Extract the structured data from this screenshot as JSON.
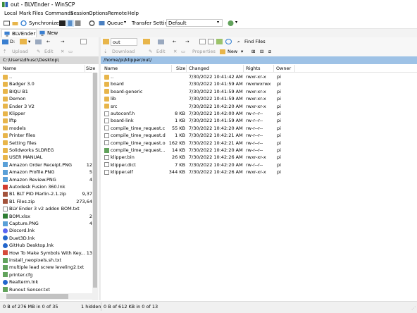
{
  "window": {
    "title": "out - BLVEnder - WinSCP"
  },
  "menu": [
    "Local",
    "Mark",
    "Files",
    "Commands",
    "Session",
    "Options",
    "Remote",
    "Help"
  ],
  "toolbar": {
    "synchronize_label": "Synchronize",
    "queue_label": "Queue",
    "transfer_settings_label": "Transfer Settings",
    "transfer_settings_value": "Default"
  },
  "tabs": [
    {
      "label": "BLVEnder",
      "active": true
    },
    {
      "label": "New Session",
      "active": false
    }
  ],
  "left_pane": {
    "drive_label": "D:",
    "upload_label": "Upload",
    "edit_label": "Edit",
    "path": "C:\\Users\\dhusc\\Desktop\\",
    "headers": {
      "name": "Name",
      "size": "Size"
    },
    "files": [
      {
        "name": "..",
        "size": "",
        "icon": "up-folder-icon"
      },
      {
        "name": "Badger 3.0",
        "size": "",
        "icon": "folder-icon"
      },
      {
        "name": "BIQU B1",
        "size": "",
        "icon": "folder-icon"
      },
      {
        "name": "Demon",
        "size": "",
        "icon": "folder-icon"
      },
      {
        "name": "Ender 3 V2",
        "size": "",
        "icon": "folder-icon"
      },
      {
        "name": "Klipper",
        "size": "",
        "icon": "folder-icon"
      },
      {
        "name": "lftp",
        "size": "",
        "icon": "folder-icon"
      },
      {
        "name": "models",
        "size": "",
        "icon": "folder-icon"
      },
      {
        "name": "Printer files",
        "size": "",
        "icon": "folder-icon"
      },
      {
        "name": "Setting files",
        "size": "",
        "icon": "folder-icon"
      },
      {
        "name": "Solidworks SLDREG",
        "size": "",
        "icon": "folder-icon"
      },
      {
        "name": "USER MANUAL",
        "size": "",
        "icon": "folder-icon"
      },
      {
        "name": "Amazon Order Receipt.PNG",
        "size": "12",
        "icon": "image-file-icon"
      },
      {
        "name": "Amazon Profile.PNG",
        "size": "5",
        "icon": "image-file-icon"
      },
      {
        "name": "Amazon Review.PNG",
        "size": "4",
        "icon": "image-file-icon"
      },
      {
        "name": "Autodesk Fusion 360.lnk",
        "size": "",
        "icon": "shortcut-file-icon"
      },
      {
        "name": "B1 BLT PID Marlin-2.1.zip",
        "size": "9,37",
        "icon": "zip-file-icon"
      },
      {
        "name": "B1 Files.zip",
        "size": "273,64",
        "icon": "zip-file-icon"
      },
      {
        "name": "BLV Ender 3 v2 addon BOM.txt",
        "size": "",
        "icon": "text-file-icon"
      },
      {
        "name": "BOM.xlsx",
        "size": "2",
        "icon": "excel-file-icon"
      },
      {
        "name": "Capture.PNG",
        "size": "4",
        "icon": "image-file-icon"
      },
      {
        "name": "Discord.lnk",
        "size": "",
        "icon": "discord-shortcut-icon"
      },
      {
        "name": "Duet3D.lnk",
        "size": "",
        "icon": "web-shortcut-icon"
      },
      {
        "name": "GitHub Desktop.lnk",
        "size": "",
        "icon": "web-shortcut-icon"
      },
      {
        "name": "How To Make Symbols With Key...",
        "size": "13",
        "icon": "pdf-file-icon"
      },
      {
        "name": "install_neopixels.sh.txt",
        "size": "",
        "icon": "green-text-file-icon"
      },
      {
        "name": "multiple lead screw leveling2.txt",
        "size": "",
        "icon": "green-text-file-icon"
      },
      {
        "name": "printer.cfg",
        "size": "",
        "icon": "green-text-file-icon"
      },
      {
        "name": "Realterm.lnk",
        "size": "",
        "icon": "web-shortcut-icon"
      },
      {
        "name": "Runout Sensor.txt",
        "size": "",
        "icon": "green-text-file-icon"
      }
    ]
  },
  "right_pane": {
    "path_dropdown": "out",
    "find_files_label": "Find Files",
    "download_label": "Download",
    "edit_label": "Edit",
    "properties_label": "Properties",
    "new_label": "New",
    "path": "/home/pi/klipper/out/",
    "headers": {
      "name": "Name",
      "size": "Size",
      "changed": "Changed",
      "rights": "Rights",
      "owner": "Owner"
    },
    "files": [
      {
        "name": "..",
        "size": "",
        "changed": "7/30/2022 10:41:42 AM",
        "rights": "rwxr-xr-x",
        "owner": "pi",
        "icon": "up-folder-icon"
      },
      {
        "name": "board",
        "size": "",
        "changed": "7/30/2022 10:41:59 AM",
        "rights": "rwxrwxrwx",
        "owner": "pi",
        "icon": "folder-icon"
      },
      {
        "name": "board-generic",
        "size": "",
        "changed": "7/30/2022 10:41:59 AM",
        "rights": "rwxr-xr-x",
        "owner": "pi",
        "icon": "folder-icon"
      },
      {
        "name": "lib",
        "size": "",
        "changed": "7/30/2022 10:41:59 AM",
        "rights": "rwxr-xr-x",
        "owner": "pi",
        "icon": "folder-icon"
      },
      {
        "name": "src",
        "size": "",
        "changed": "7/30/2022 10:42:20 AM",
        "rights": "rwxr-xr-x",
        "owner": "pi",
        "icon": "folder-icon"
      },
      {
        "name": "autoconf.h",
        "size": "8 KB",
        "changed": "7/30/2022 10:42:00 AM",
        "rights": "rw-r--r--",
        "owner": "pi",
        "icon": "text-file-icon"
      },
      {
        "name": "board-link",
        "size": "1 KB",
        "changed": "7/30/2022 10:41:59 AM",
        "rights": "rw-r--r--",
        "owner": "pi",
        "icon": "text-file-icon"
      },
      {
        "name": "compile_time_request.c",
        "size": "55 KB",
        "changed": "7/30/2022 10:42:20 AM",
        "rights": "rw-r--r--",
        "owner": "pi",
        "icon": "text-file-icon"
      },
      {
        "name": "compile_time_request.d",
        "size": "1 KB",
        "changed": "7/30/2022 10:42:21 AM",
        "rights": "rw-r--r--",
        "owner": "pi",
        "icon": "text-file-icon"
      },
      {
        "name": "compile_time_request.o",
        "size": "162 KB",
        "changed": "7/30/2022 10:42:21 AM",
        "rights": "rw-r--r--",
        "owner": "pi",
        "icon": "text-file-icon"
      },
      {
        "name": "compile_time_request...",
        "size": "14 KB",
        "changed": "7/30/2022 10:42:20 AM",
        "rights": "rw-r--r--",
        "owner": "pi",
        "icon": "green-text-file-icon"
      },
      {
        "name": "klipper.bin",
        "size": "26 KB",
        "changed": "7/30/2022 10:42:26 AM",
        "rights": "rwxr-xr-x",
        "owner": "pi",
        "icon": "text-file-icon"
      },
      {
        "name": "klipper.dict",
        "size": "7 KB",
        "changed": "7/30/2022 10:42:20 AM",
        "rights": "rw-r--r--",
        "owner": "pi",
        "icon": "text-file-icon"
      },
      {
        "name": "klipper.elf",
        "size": "344 KB",
        "changed": "7/30/2022 10:42:26 AM",
        "rights": "rwxr-xr-x",
        "owner": "pi",
        "icon": "text-file-icon"
      }
    ]
  },
  "status": {
    "left": "0 B of 276 MB in 0 of 35",
    "hidden": "1 hidden",
    "right": "0 B of 612 KB in 0 of 13"
  },
  "colors": {
    "remote_path_bg": "#9ec2e6",
    "local_path_bg": "#d9d9d9",
    "folder": "#e8b54a"
  }
}
